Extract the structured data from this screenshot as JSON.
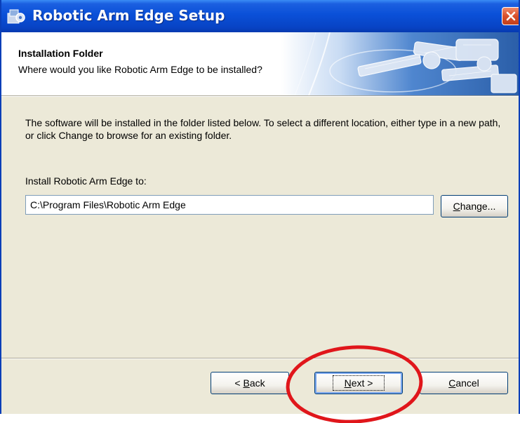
{
  "window": {
    "title": "Robotic Arm Edge Setup",
    "close_glyph": "✕"
  },
  "header": {
    "title": "Installation Folder",
    "subtitle": "Where would you like Robotic Arm Edge to be installed?"
  },
  "body": {
    "description": "The software will be installed in the folder listed below. To select a different location, either type in a new path, or click Change to browse for an existing folder.",
    "install_label": "Install Robotic Arm Edge to:",
    "install_path": "C:\\Program Files\\Robotic Arm Edge"
  },
  "buttons": {
    "change": {
      "accel": "C",
      "rest": "hange..."
    },
    "back": {
      "prefix": "< ",
      "accel": "B",
      "rest": "ack"
    },
    "next": {
      "accel": "N",
      "rest": "ext >"
    },
    "cancel": {
      "accel": "C",
      "rest": "ancel"
    }
  },
  "icons": {
    "app": "setup-app-icon",
    "close": "close-icon",
    "header_art": "robotic-arm-illustration"
  },
  "colors": {
    "titlebar": "#0a50d8",
    "dialog_bg": "#ece9d8",
    "close": "#d9502c",
    "annotation_circle": "#e0161b"
  }
}
